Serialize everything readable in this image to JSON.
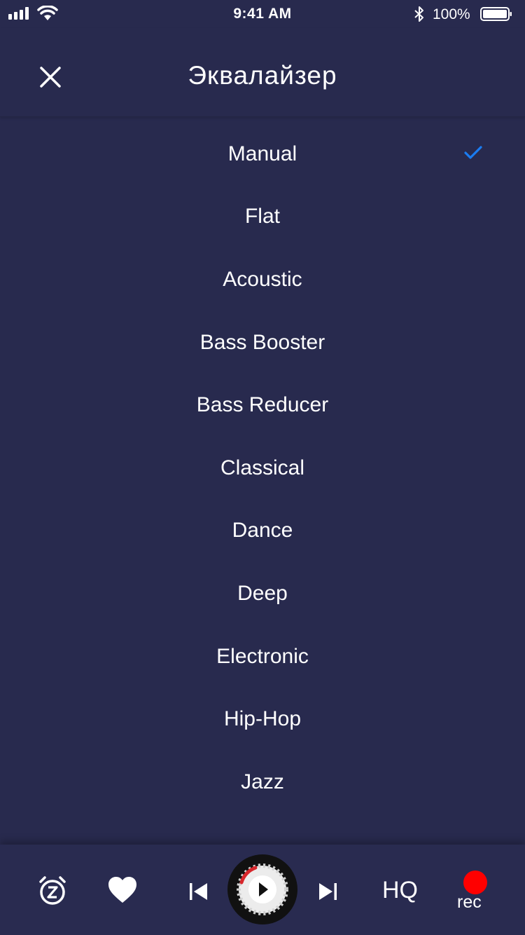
{
  "status_bar": {
    "time": "9:41 AM",
    "battery_percent": "100%",
    "icons": [
      "signal-icon",
      "wifi-icon",
      "bluetooth-icon",
      "battery-icon"
    ]
  },
  "header": {
    "title": "Эквалайзер",
    "close_icon": "close-icon"
  },
  "presets": {
    "selected": "Manual",
    "items": [
      {
        "label": "Manual"
      },
      {
        "label": "Flat"
      },
      {
        "label": "Acoustic"
      },
      {
        "label": "Bass Booster"
      },
      {
        "label": "Bass Reducer"
      },
      {
        "label": "Classical"
      },
      {
        "label": "Dance"
      },
      {
        "label": "Deep"
      },
      {
        "label": "Electronic"
      },
      {
        "label": "Hip-Hop"
      },
      {
        "label": "Jazz"
      }
    ]
  },
  "player": {
    "icons": [
      "alarm-sleep-icon",
      "heart-icon",
      "previous-icon",
      "play-icon",
      "next-icon"
    ],
    "hq_label": "HQ",
    "rec_label": "rec"
  },
  "colors": {
    "background": "#282a4e",
    "check_accent": "#1a7cf2",
    "rec_red": "#ff0000"
  }
}
